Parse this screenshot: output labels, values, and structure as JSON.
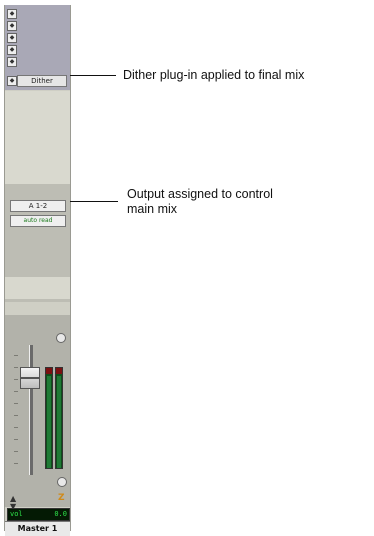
{
  "strip": {
    "insert_slot_label": "Dither",
    "output_button": "A 1-2",
    "automation_button": "auto read",
    "volume_label": "vol",
    "volume_value": "0.0",
    "track_name": "Master 1"
  },
  "callouts": {
    "dither": "Dither plug-in applied to final mix",
    "output_line1": "Output assigned to control",
    "output_line2": "main mix"
  },
  "icons": {
    "insert_selector": "up-down-arrows-icon",
    "group_icon": "z-group-icon"
  }
}
